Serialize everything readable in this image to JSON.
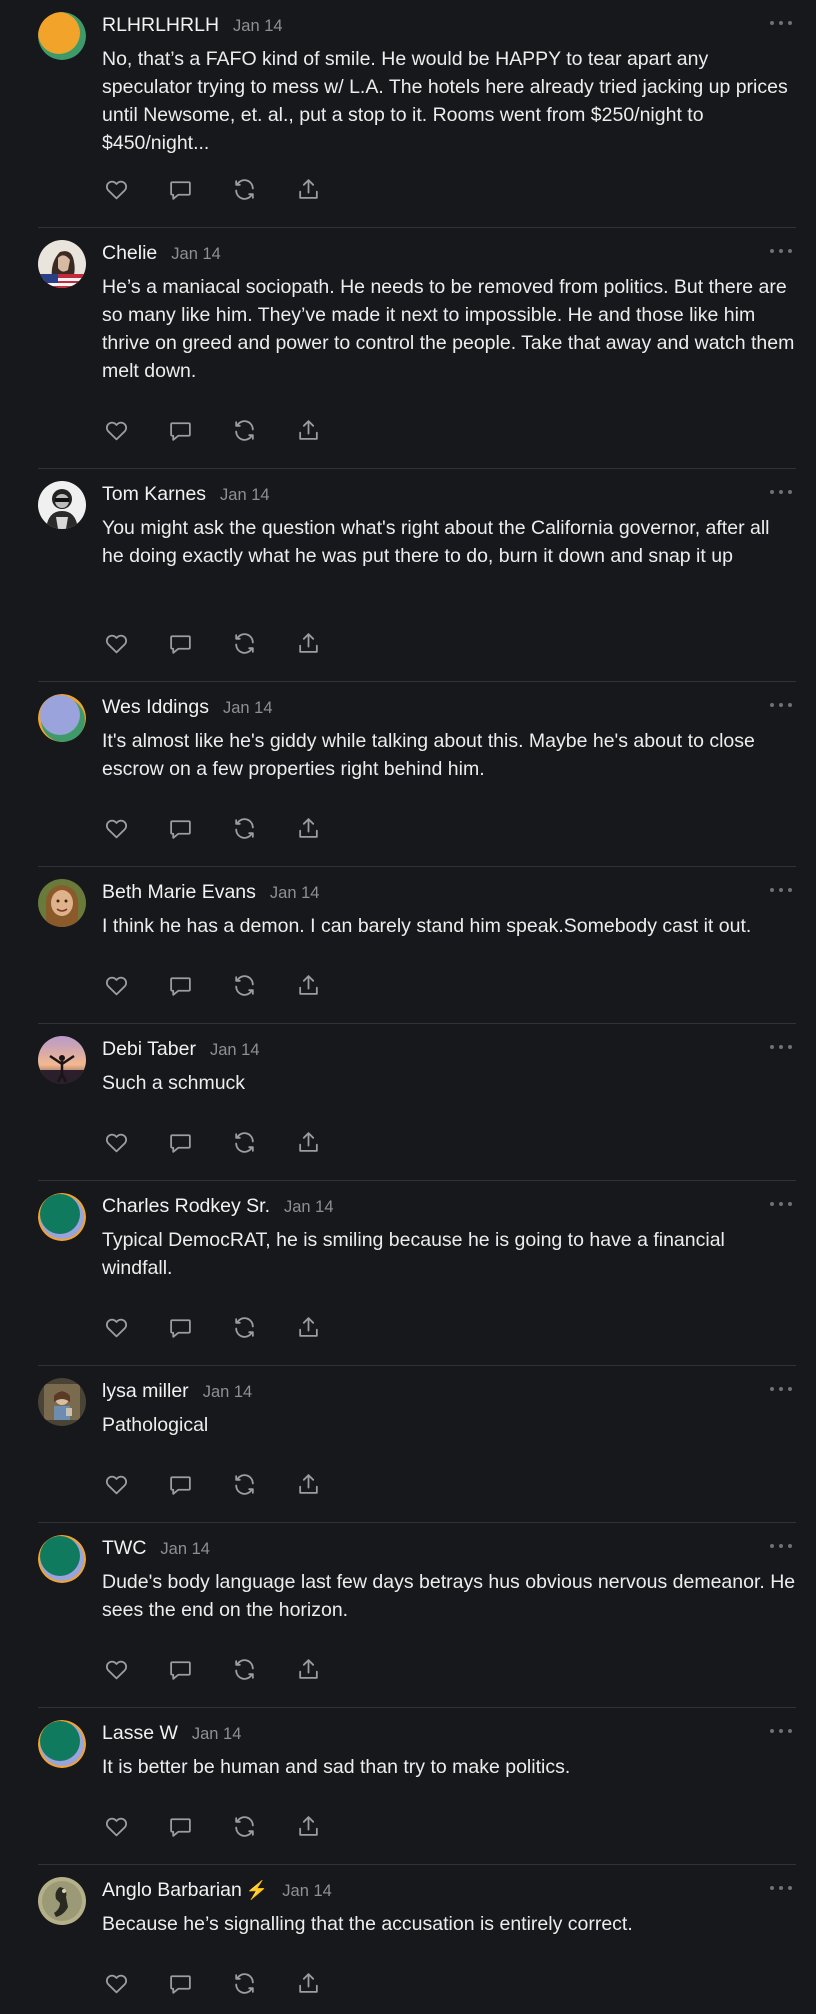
{
  "colors": {
    "background": "#17181b",
    "divider": "#303236",
    "muted_text": "#8d8f94",
    "icon": "#9b9da1",
    "bolt": "#f5c518"
  },
  "icons": {
    "like": "heart-icon",
    "reply": "speech-bubble-icon",
    "restack": "restack-icon",
    "share": "share-upload-icon",
    "more": "ellipsis-icon"
  },
  "comments": [
    {
      "name": "RLHRLHRLH",
      "date": "Jan 14",
      "text": "No, that’s a FAFO kind of smile. He would be HAPPY to tear apart any speculator trying to mess w/ L.A. The hotels here already tried jacking up prices until Newsome, et. al., put a stop to it. Rooms went from $250/night to $450/night..."
    },
    {
      "name": "Chelie",
      "date": "Jan 14",
      "text": "He’s a maniacal sociopath. He needs to be removed from politics. But there are so many like him. They’ve made it next to impossible. He and those like him thrive on greed and power to control the people. Take that away and watch them melt down."
    },
    {
      "name": "Tom Karnes",
      "date": "Jan 14",
      "text": "You might ask the question what's right about the California governor, after all he doing exactly what he was put there to do, burn it down and snap it up"
    },
    {
      "name": "Wes Iddings",
      "date": "Jan 14",
      "text": "It's almost like he's giddy while talking about this. Maybe he's about to close escrow on a few properties right behind him."
    },
    {
      "name": "Beth Marie Evans",
      "date": "Jan 14",
      "text": "I think he has a demon. I can barely stand him speak.Somebody cast it out."
    },
    {
      "name": "Debi Taber",
      "date": "Jan 14",
      "text": "Such a schmuck"
    },
    {
      "name": "Charles Rodkey Sr.",
      "date": "Jan 14",
      "text": "Typical DemocRAT, he is smiling because he is going to have a financial windfall."
    },
    {
      "name": "lysa miller",
      "date": "Jan 14",
      "text": "Pathological"
    },
    {
      "name": "TWC",
      "date": "Jan 14",
      "text": "Dude's body language last few days betrays hus obvious nervous demeanor. He sees the end on the horizon."
    },
    {
      "name": "Lasse W",
      "date": "Jan 14",
      "text": "It is better be human and sad than try to make politics."
    },
    {
      "name": "Anglo Barbarian",
      "badge": "⚡",
      "date": "Jan 14",
      "text": "Because he’s signalling that the accusation is entirely correct."
    }
  ]
}
